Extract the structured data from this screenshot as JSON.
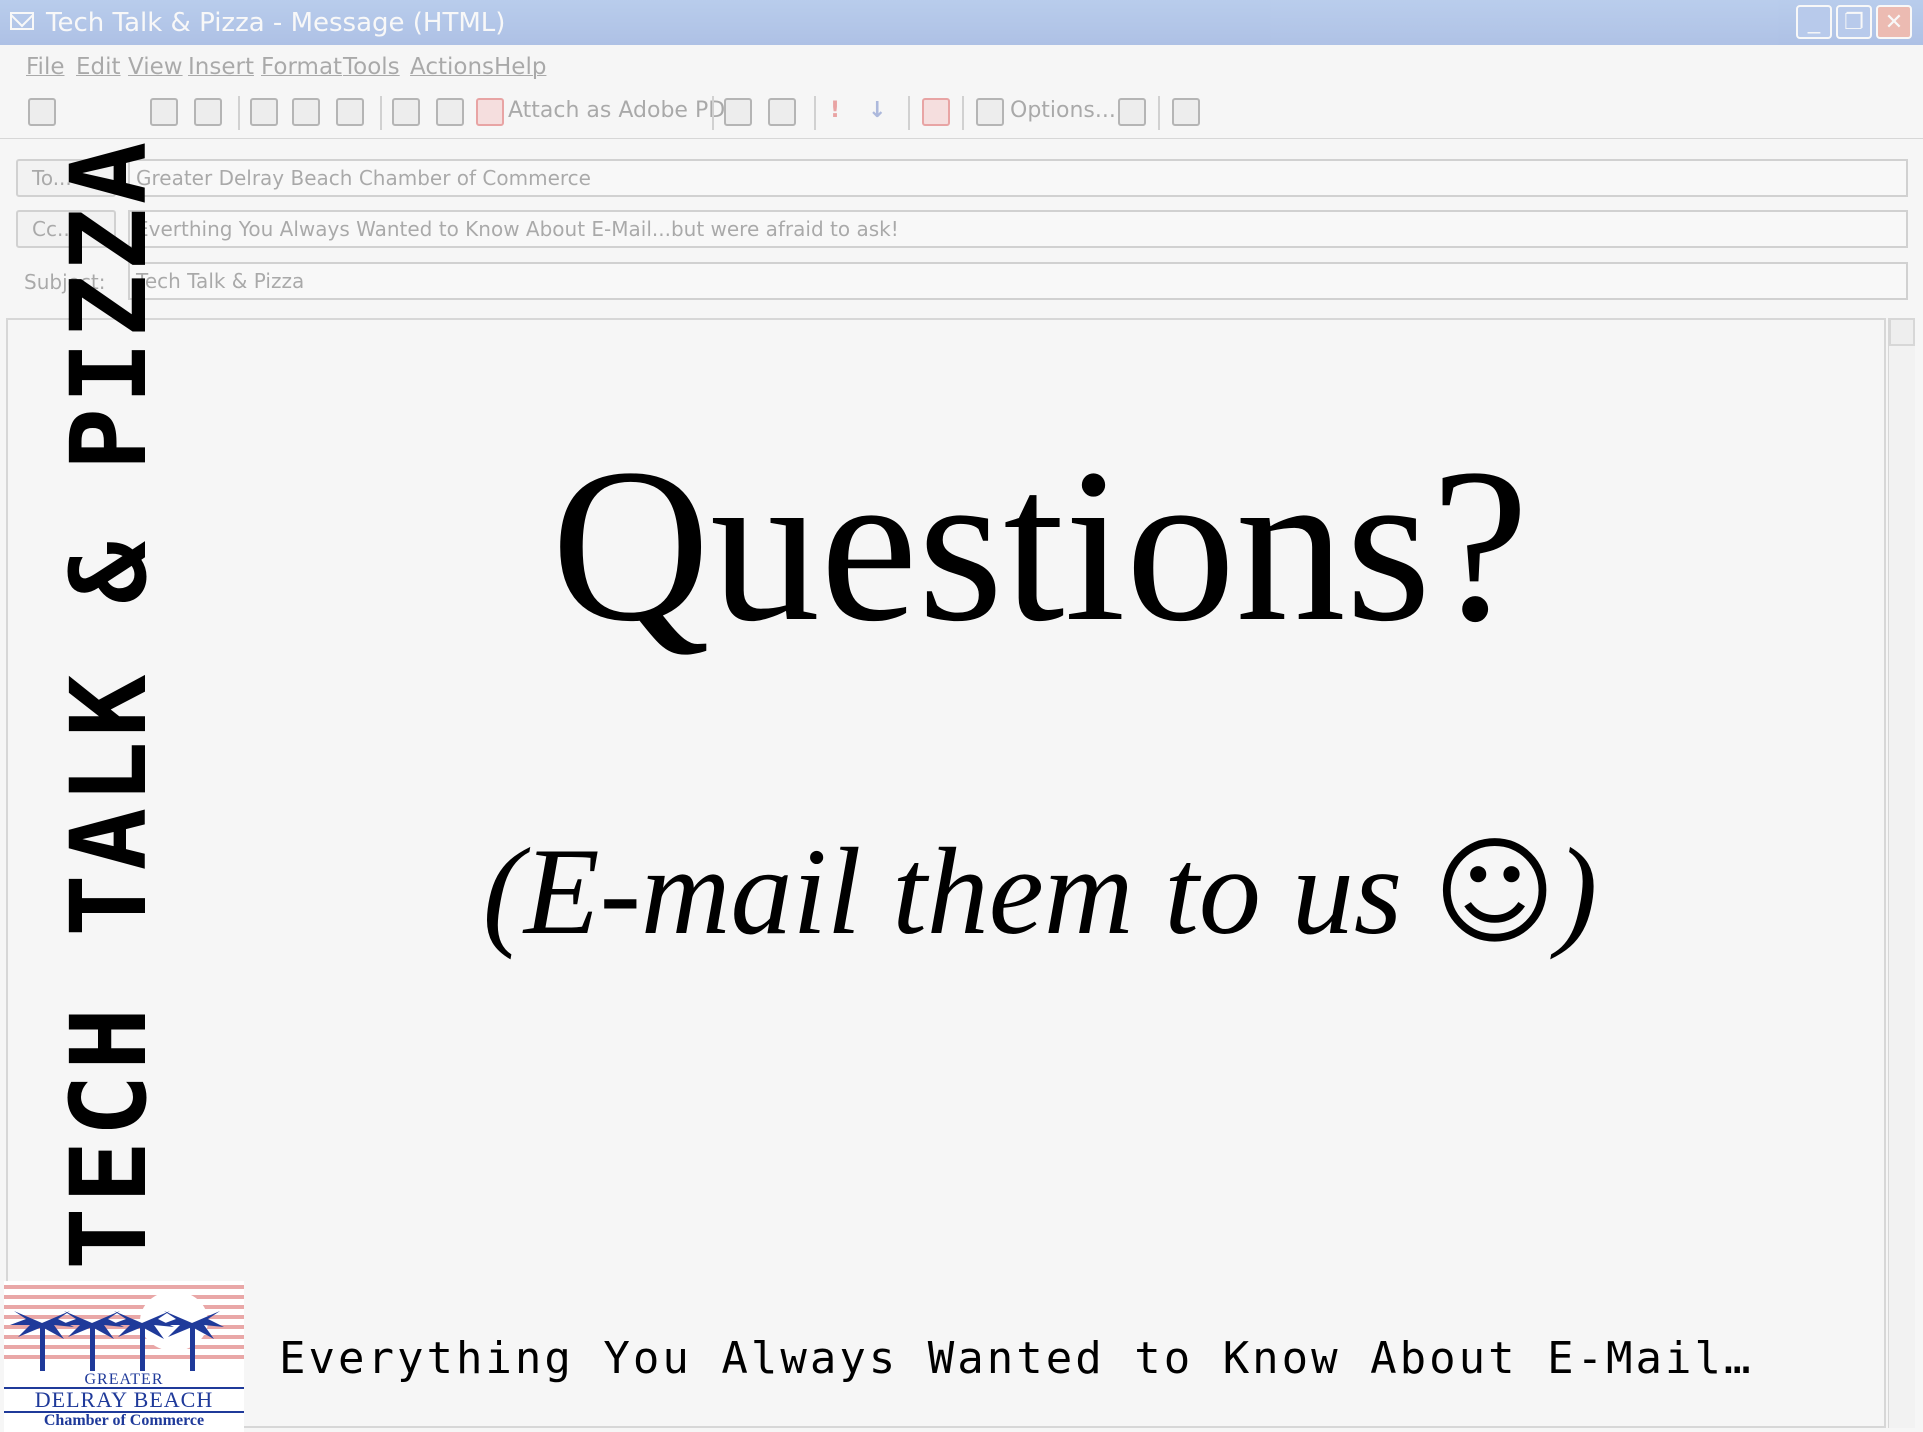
{
  "window": {
    "title": "Tech Talk & Pizza - Message (HTML)",
    "minimize_glyph": "_",
    "restore_glyph": "❐",
    "close_glyph": "✕"
  },
  "menu": {
    "items": [
      "File",
      "Edit",
      "View",
      "Insert",
      "Format",
      "Tools",
      "Actions",
      "Help"
    ]
  },
  "toolbar": {
    "attach_pdf_label": "Attach as Adobe PDF",
    "options_label": "Options...",
    "importance_high_glyph": "!",
    "importance_low_glyph": "↓"
  },
  "header": {
    "to_button": "To...",
    "to_value": "Greater Delray Beach Chamber of Commerce",
    "cc_button": "Cc...",
    "cc_value": "Everthing You Always Wanted to Know About E-Mail...but were afraid to ask!",
    "subject_label": "Subject:",
    "subject_value": "Tech Talk & Pizza"
  },
  "slide": {
    "vertical_title": "TECH TALK & PIZZA",
    "question": "Questions?",
    "subline_prefix": "(E-mail them to us ",
    "smiley": "☺",
    "subline_suffix": ")",
    "footer_tagline": "Everything You Always Wanted to Know About E-Mail…"
  },
  "logo": {
    "line1": "GREATER",
    "line2": "DELRAY BEACH",
    "line3": "Chamber of Commerce",
    "colors": {
      "navy": "#1f3a9a",
      "stripe": "#e9a7a7"
    }
  }
}
